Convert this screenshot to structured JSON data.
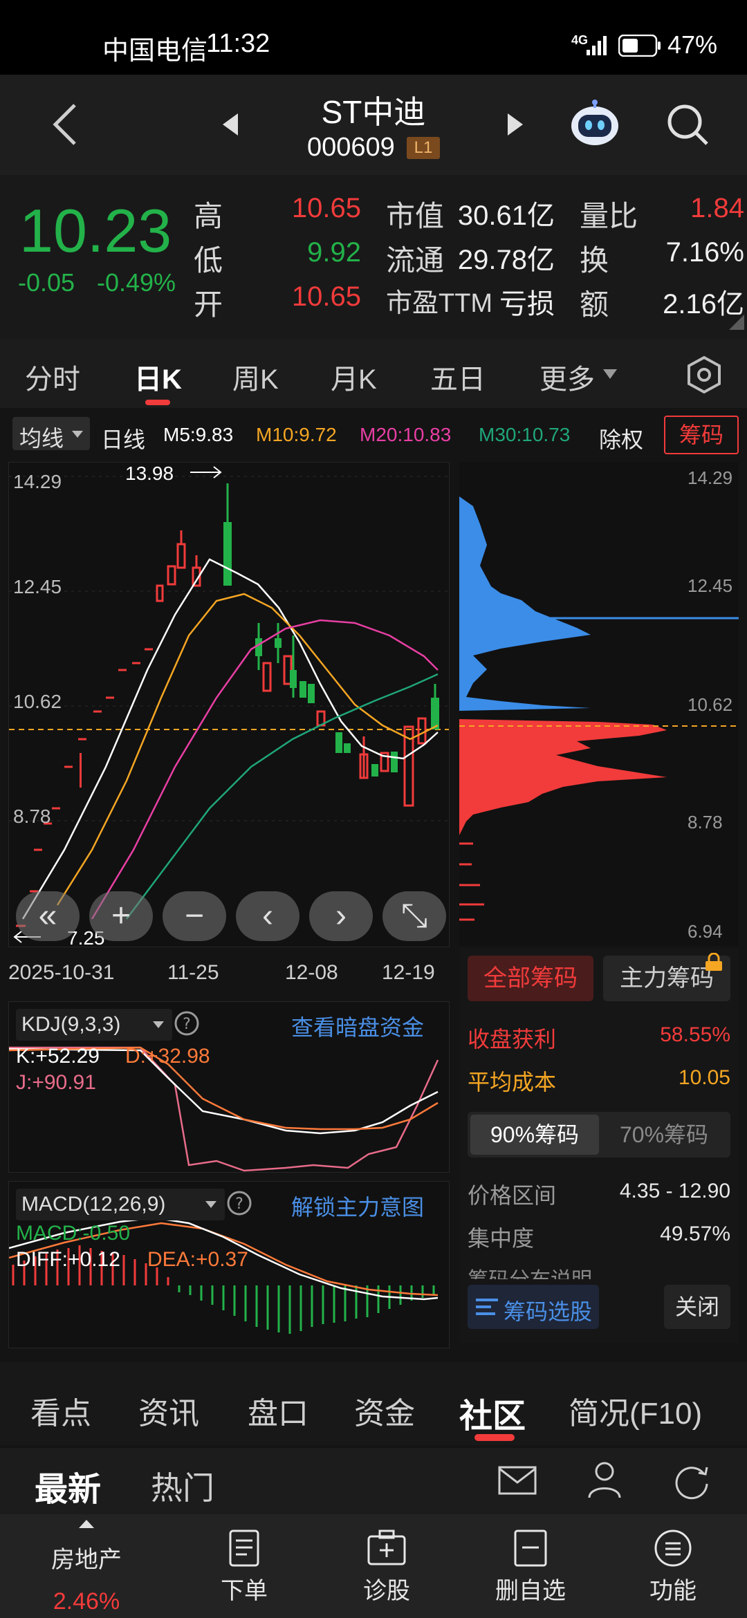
{
  "status_bar": {
    "carrier": "中国电信",
    "time": "11:32",
    "network": "4G",
    "battery": "47%"
  },
  "header": {
    "title": "ST中迪",
    "code": "000609",
    "level_badge": "L1"
  },
  "quote": {
    "price": "10.23",
    "change": "-0.05",
    "change_pct": "-0.49%",
    "high_label": "高",
    "high": "10.65",
    "low_label": "低",
    "low": "9.92",
    "open_label": "开",
    "open": "10.65",
    "mktcap_label": "市值",
    "mktcap": "30.61亿",
    "float_label": "流通",
    "float": "29.78亿",
    "pe_label": "市盈TTM",
    "pe": "亏损",
    "vol_ratio_label": "量比",
    "vol_ratio": "1.84",
    "turnover_label": "换",
    "turnover": "7.16%",
    "amount_label": "额",
    "amount": "2.16亿"
  },
  "period_tabs": [
    "分时",
    "日K",
    "周K",
    "月K",
    "五日",
    "更多"
  ],
  "ma_bar": {
    "indicator_select": "均线",
    "period": "日线",
    "m5": "M5:9.83",
    "m10": "M10:9.72",
    "m20": "M20:10.83",
    "m30": "M30:10.73",
    "adjust": "除权",
    "chips_btn": "筹码"
  },
  "kline": {
    "y_labels": [
      "14.29",
      "12.45",
      "10.62",
      "8.78"
    ],
    "high_marker": "13.98",
    "low_marker": "7.25",
    "x_labels": [
      "2025-10-31",
      "11-25",
      "12-08",
      "12-19"
    ]
  },
  "chips_panel": {
    "y_labels": [
      "14.29",
      "12.45",
      "10.62",
      "8.78",
      "6.94"
    ],
    "tab_all": "全部筹码",
    "tab_main": "主力筹码",
    "profit_label": "收盘获利",
    "profit": "58.55%",
    "avg_cost_label": "平均成本",
    "avg_cost": "10.05",
    "pct90": "90%筹码",
    "pct70": "70%筹码",
    "range_label": "价格区间",
    "range": "4.35 - 12.90",
    "concentration_label": "集中度",
    "concentration": "49.57%",
    "desc_label": "筹码分布说明",
    "select_btn": "筹码选股",
    "close_btn": "关闭"
  },
  "kdj": {
    "select": "KDJ(9,3,3)",
    "link": "查看暗盘资金",
    "k": "K:+52.29",
    "d": "D:+32.98",
    "j": "J:+90.91"
  },
  "macd": {
    "select": "MACD(12,26,9)",
    "link": "解锁主力意图",
    "macd": "MACD:-0.50",
    "diff": "DIFF:+0.12",
    "dea": "DEA:+0.37"
  },
  "bottom_tabs": [
    "看点",
    "资讯",
    "盘口",
    "资金",
    "社区",
    "简况(F10)"
  ],
  "feed_tabs": {
    "latest": "最新",
    "hot": "热门"
  },
  "nav": {
    "sector": "房地产",
    "sector_pct": "2.46%",
    "items": [
      "下单",
      "诊股",
      "删自选",
      "功能"
    ]
  },
  "colors": {
    "up": "#f23b3b",
    "down": "#23b24a",
    "accent": "#f23b3b",
    "link": "#4a8fe6"
  }
}
